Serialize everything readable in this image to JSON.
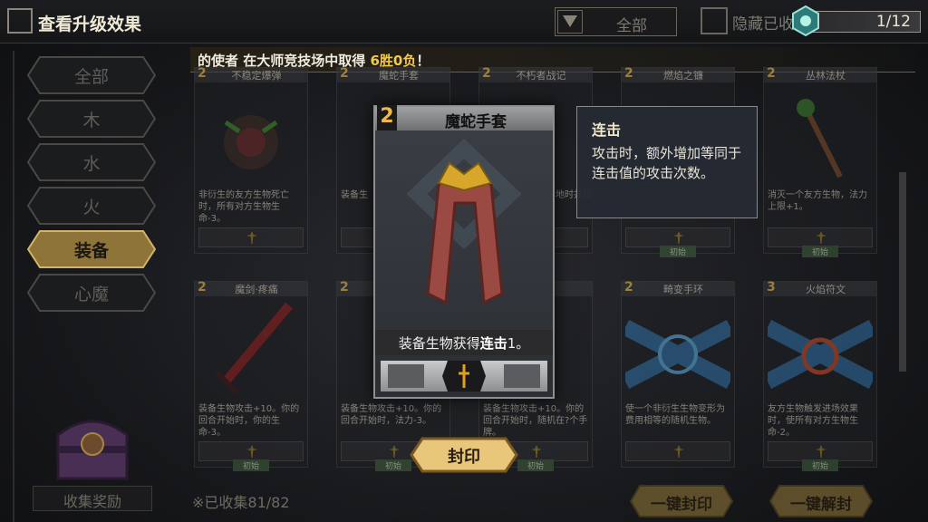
{
  "header": {
    "upgrade_label": "查看升级效果",
    "filter_value": "全部",
    "hide_label": "隐藏已收",
    "counter": "1/12"
  },
  "ticker": {
    "prefix": "的使者 在大师竞技场中取得 ",
    "highlight": "6胜0负",
    "suffix": "！"
  },
  "categories": [
    {
      "label": "全部"
    },
    {
      "label": "木"
    },
    {
      "label": "水"
    },
    {
      "label": "火"
    },
    {
      "label": "装备"
    },
    {
      "label": "心魔"
    }
  ],
  "active_category": "装备",
  "chest_label": "收集奖励",
  "collected": "※已收集81/82",
  "cards": [
    {
      "cost": "2",
      "name": "不稳定爆弹",
      "desc": "非衍生的友方生物死亡时，所有对方生物生命-3。",
      "tag": ""
    },
    {
      "cost": "2",
      "name": "魔蛇手套",
      "desc": "装备生",
      "tag": ""
    },
    {
      "cost": "2",
      "name": "不朽者战记",
      "desc": "地时并使",
      "tag": ""
    },
    {
      "cost": "2",
      "name": "燃焰之镰",
      "desc": "",
      "tag": "初始"
    },
    {
      "cost": "2",
      "name": "丛林法杖",
      "desc": "消灭一个友方生物，法力上限+1。",
      "tag": "初始"
    },
    {
      "cost": "2",
      "name": "魔剑·疼痛",
      "desc": "装备生物攻击+10。你的回合开始时，你的生命-3。",
      "tag": "初始"
    },
    {
      "cost": "2",
      "name": "魔",
      "desc": "装备生物攻击+10。你的回合开始时，法力-3。",
      "tag": "初始"
    },
    {
      "cost": "2",
      "name": "存",
      "desc": "装备生物攻击+10。你的回合开始时，随机在?个手牌。",
      "tag": "初始"
    },
    {
      "cost": "2",
      "name": "畸变手环",
      "desc": "使一个非衍生生物变形为费用相等的随机生物。",
      "tag": ""
    },
    {
      "cost": "3",
      "name": "火焰符文",
      "desc": "友方生物触发进场效果时，使所有对方生物生命-2。",
      "tag": "初始"
    }
  ],
  "featured": {
    "cost": "2",
    "name": "魔蛇手套",
    "desc_prefix": "装备生物获得",
    "desc_keyword": "连击",
    "desc_suffix": "1。"
  },
  "tooltip": {
    "title": "连击",
    "body": "攻击时，额外增加等同于连击值的攻击次数。"
  },
  "buttons": {
    "seal": "封印",
    "seal_all": "一键封印",
    "unseal_all": "一键解封"
  },
  "colors": {
    "gold": "#f2c94c",
    "accent_bronze": "#c9a24a"
  }
}
